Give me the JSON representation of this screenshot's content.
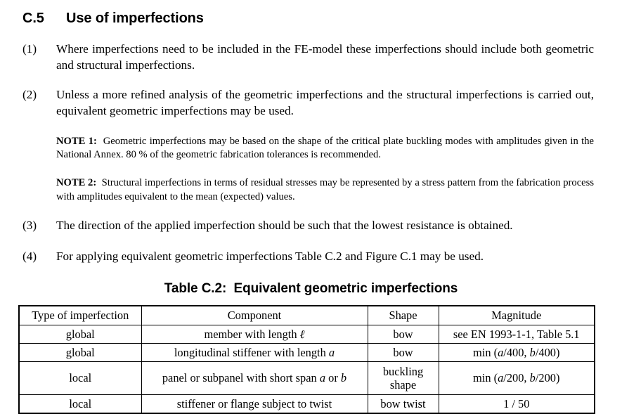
{
  "section": {
    "number": "C.5",
    "title": "Use of imperfections"
  },
  "clauses": [
    {
      "number": "(1)",
      "text": "Where imperfections need to be included in the FE-model these imperfections should include both geometric and structural imperfections."
    },
    {
      "number": "(2)",
      "text": "Unless a more refined analysis of the geometric imperfections and the structural imperfections is carried out, equivalent geometric imperfections may be used."
    },
    {
      "number": "(3)",
      "text": "The direction of the applied imperfection should be such that the lowest resistance is obtained."
    },
    {
      "number": "(4)",
      "text": "For applying equivalent geometric imperfections Table C.2 and Figure C.1 may be used."
    }
  ],
  "notes": [
    {
      "label": "NOTE 1:",
      "text": "Geometric imperfections may be based on the shape of the critical plate buckling modes with amplitudes given in the National Annex. 80 % of the geometric fabrication tolerances is recommended."
    },
    {
      "label": "NOTE 2:",
      "text": "Structural imperfections in terms of residual stresses may be represented by a stress pattern from the fabrication process with amplitudes equivalent to the mean (expected) values."
    }
  ],
  "table": {
    "caption_label": "Table C.2:",
    "caption_text": "Equivalent geometric imperfections",
    "headers": [
      "Type of imperfection",
      "Component",
      "Shape",
      "Magnitude"
    ],
    "rows": [
      {
        "type": "global",
        "component_prefix": "member with length",
        "component_var": "ℓ",
        "component_suffix": "",
        "shape": "bow",
        "magnitude_plain": "see EN 1993-1-1, Table 5.1",
        "magnitude_parts": null
      },
      {
        "type": "global",
        "component_prefix": "longitudinal stiffener with length",
        "component_var": "a",
        "component_suffix": "",
        "shape": "bow",
        "magnitude_plain": null,
        "magnitude_parts": {
          "fn": "min (",
          "v1": "a",
          "d1": "/400, ",
          "v2": "b",
          "d2": "/400)"
        }
      },
      {
        "type": "local",
        "component_prefix": "panel or subpanel with short span",
        "component_var": "a",
        "component_mid": "or",
        "component_var2": "b",
        "component_suffix": "",
        "shape": "buckling shape",
        "magnitude_plain": null,
        "magnitude_parts": {
          "fn": "min (",
          "v1": "a",
          "d1": "/200, ",
          "v2": "b",
          "d2": "/200)"
        }
      },
      {
        "type": "local",
        "component_prefix": "stiffener or flange subject to twist",
        "component_var": "",
        "component_suffix": "",
        "shape": "bow twist",
        "magnitude_plain": "1 / 50",
        "magnitude_parts": null
      }
    ]
  }
}
